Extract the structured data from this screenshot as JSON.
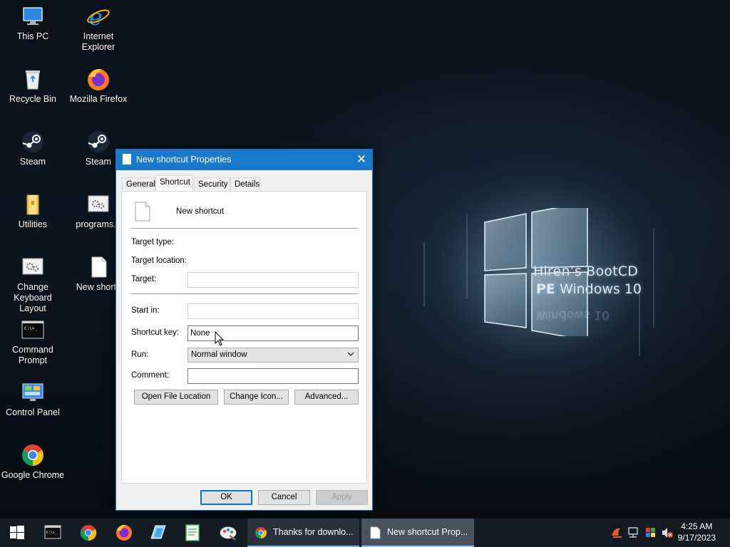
{
  "wallpaper": {
    "line1": "Hiren’s BootCD",
    "line2_bold": "PE",
    "line2_rest": " Windows 10",
    "line3_reflection": "Windows 10"
  },
  "desktop_icons": [
    {
      "name": "this-pc",
      "label": "This PC",
      "icon": "computer-icon"
    },
    {
      "name": "internet-explorer",
      "label": "Internet Explorer",
      "icon": "ie-icon"
    },
    {
      "name": "recycle-bin",
      "label": "Recycle Bin",
      "icon": "recycle-bin-icon"
    },
    {
      "name": "mozilla-firefox",
      "label": "Mozilla Firefox",
      "icon": "firefox-icon"
    },
    {
      "name": "steam-1",
      "label": "Steam",
      "icon": "steam-icon"
    },
    {
      "name": "steam-2",
      "label": "Steam",
      "icon": "steam-icon"
    },
    {
      "name": "utilities",
      "label": "Utilities",
      "icon": "folder-icon"
    },
    {
      "name": "programs-bat",
      "label": "programs.b",
      "icon": "settings-file-icon"
    },
    {
      "name": "change-keyboard-layout",
      "label": "Change Keyboard Layout",
      "icon": "settings-file-icon"
    },
    {
      "name": "new-shortcut",
      "label": "New shortc",
      "icon": "blank-file-icon"
    },
    {
      "name": "command-prompt",
      "label": "Command Prompt",
      "icon": "cmd-icon"
    },
    {
      "name": "control-panel",
      "label": "Control Panel",
      "icon": "control-panel-icon"
    },
    {
      "name": "google-chrome",
      "label": "Google Chrome",
      "icon": "chrome-icon"
    }
  ],
  "dialog": {
    "title": "New shortcut Properties",
    "close_label": "✕",
    "tabs": [
      "General",
      "Shortcut",
      "Security",
      "Details"
    ],
    "active_tab": "Shortcut",
    "file_name": "New shortcut",
    "target_type_label": "Target type:",
    "target_location_label": "Target location:",
    "target_label": "Target:",
    "target_value": "",
    "start_in_label": "Start in:",
    "start_in_value": "",
    "shortcut_key_label": "Shortcut key:",
    "shortcut_key_value": "None",
    "run_label": "Run:",
    "run_value": "Normal window",
    "comment_label": "Comment:",
    "comment_value": "",
    "open_file_location": "Open File Location",
    "change_icon": "Change Icon...",
    "advanced": "Advanced...",
    "ok": "OK",
    "cancel": "Cancel",
    "apply": "Apply"
  },
  "taskbar": {
    "pinned": [
      "start-icon",
      "cmd-icon",
      "chrome-icon",
      "firefox-icon",
      "explorer-icon",
      "notepad-icon",
      "paint-icon"
    ],
    "items": [
      {
        "label": "Thanks for downlo...",
        "icon": "chrome-icon"
      },
      {
        "label": "New shortcut Prop...",
        "icon": "blank-file-icon",
        "active": true
      }
    ],
    "time": "4:25 AM",
    "date": "9/17/2023"
  },
  "colors": {
    "titlebar": "#1979ca",
    "accent": "#0078d7",
    "taskbar": "#141a22"
  }
}
